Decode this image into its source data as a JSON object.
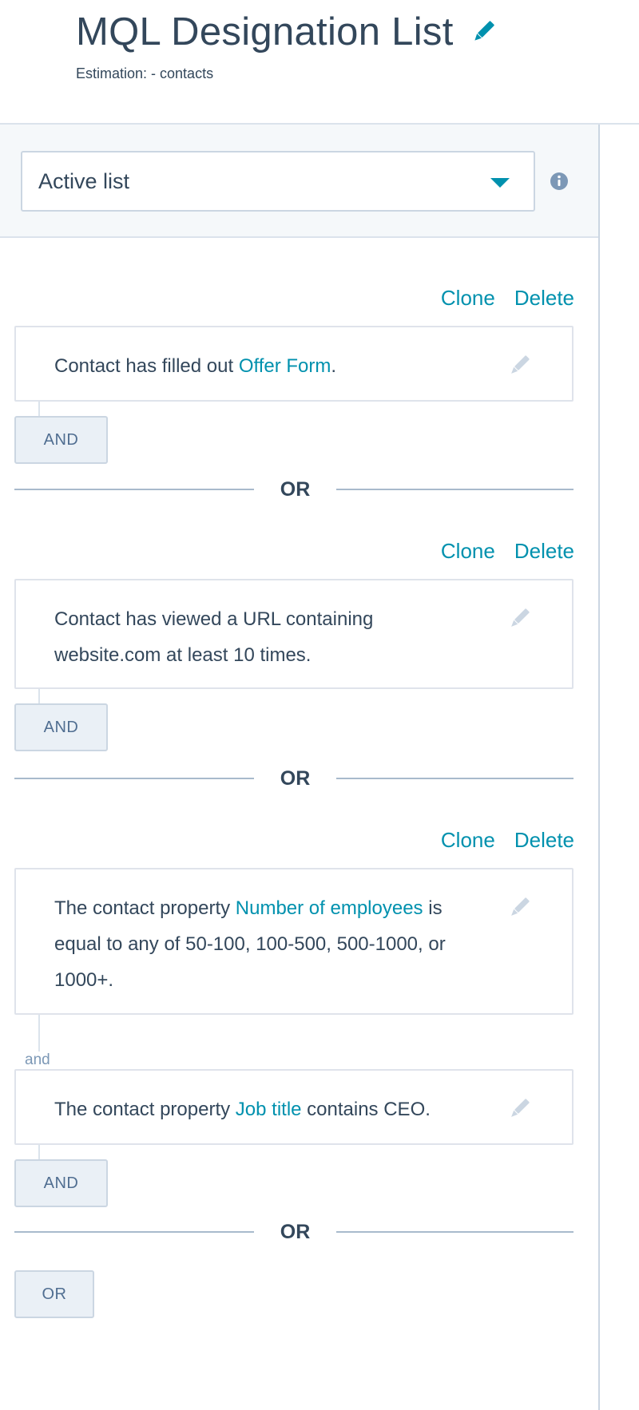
{
  "header": {
    "title": "MQL Designation List",
    "subtitle": "Estimation: - contacts"
  },
  "list_type": {
    "selected": "Active list"
  },
  "groups": [
    {
      "clone": "Clone",
      "delete": "Delete",
      "filters": [
        {
          "parts": [
            "Contact has filled out ",
            "Offer Form",
            "."
          ]
        }
      ],
      "and_button": "AND"
    },
    {
      "clone": "Clone",
      "delete": "Delete",
      "filters": [
        {
          "parts": [
            "Contact has viewed a URL containing website.com at least 10 times."
          ]
        }
      ],
      "and_button": "AND"
    },
    {
      "clone": "Clone",
      "delete": "Delete",
      "filters": [
        {
          "parts": [
            "The contact property ",
            "Number of employees",
            " is equal to any of 50-100, 100-500, 500-1000, or 1000+."
          ]
        },
        {
          "parts": [
            "The contact property ",
            "Job title",
            " contains CEO."
          ]
        }
      ],
      "and_connector": "and",
      "and_button": "AND"
    }
  ],
  "or_divider": "OR",
  "or_button": "OR",
  "colors": {
    "link": "#0091ae",
    "text": "#33475b",
    "panel_bg": "#f5f8fa",
    "border": "#cbd6e2"
  },
  "icons": {
    "title_edit": "pencil-icon",
    "filter_edit": "pencil-icon",
    "info": "info-circle-icon",
    "dropdown": "caret-down-icon"
  }
}
